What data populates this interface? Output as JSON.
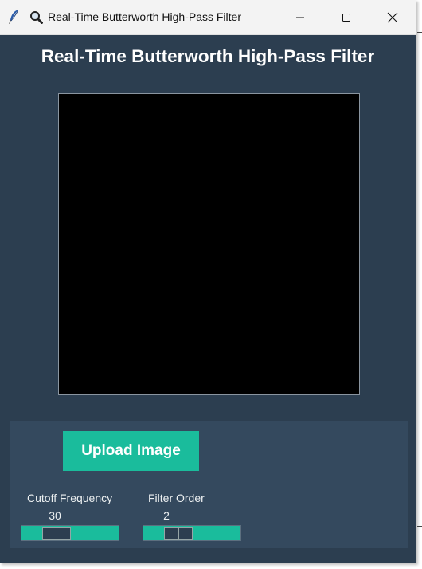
{
  "window": {
    "title": "Real-Time Butterworth High-Pass Filter",
    "controls": {
      "minimize": "minimize",
      "maximize": "maximize",
      "close": "close"
    }
  },
  "main": {
    "heading": "Real-Time Butterworth High-Pass Filter",
    "image_canvas": {
      "background": "#000000"
    }
  },
  "controls": {
    "upload_label": "Upload Image",
    "cutoff": {
      "label": "Cutoff Frequency",
      "value": "30",
      "thumb_fraction": 0.3
    },
    "order": {
      "label": "Filter Order",
      "value": "2",
      "thumb_fraction": 0.3
    }
  },
  "colors": {
    "background": "#2c3e50",
    "panel": "#34495e",
    "accent": "#1abc9c",
    "text": "#ffffff"
  }
}
